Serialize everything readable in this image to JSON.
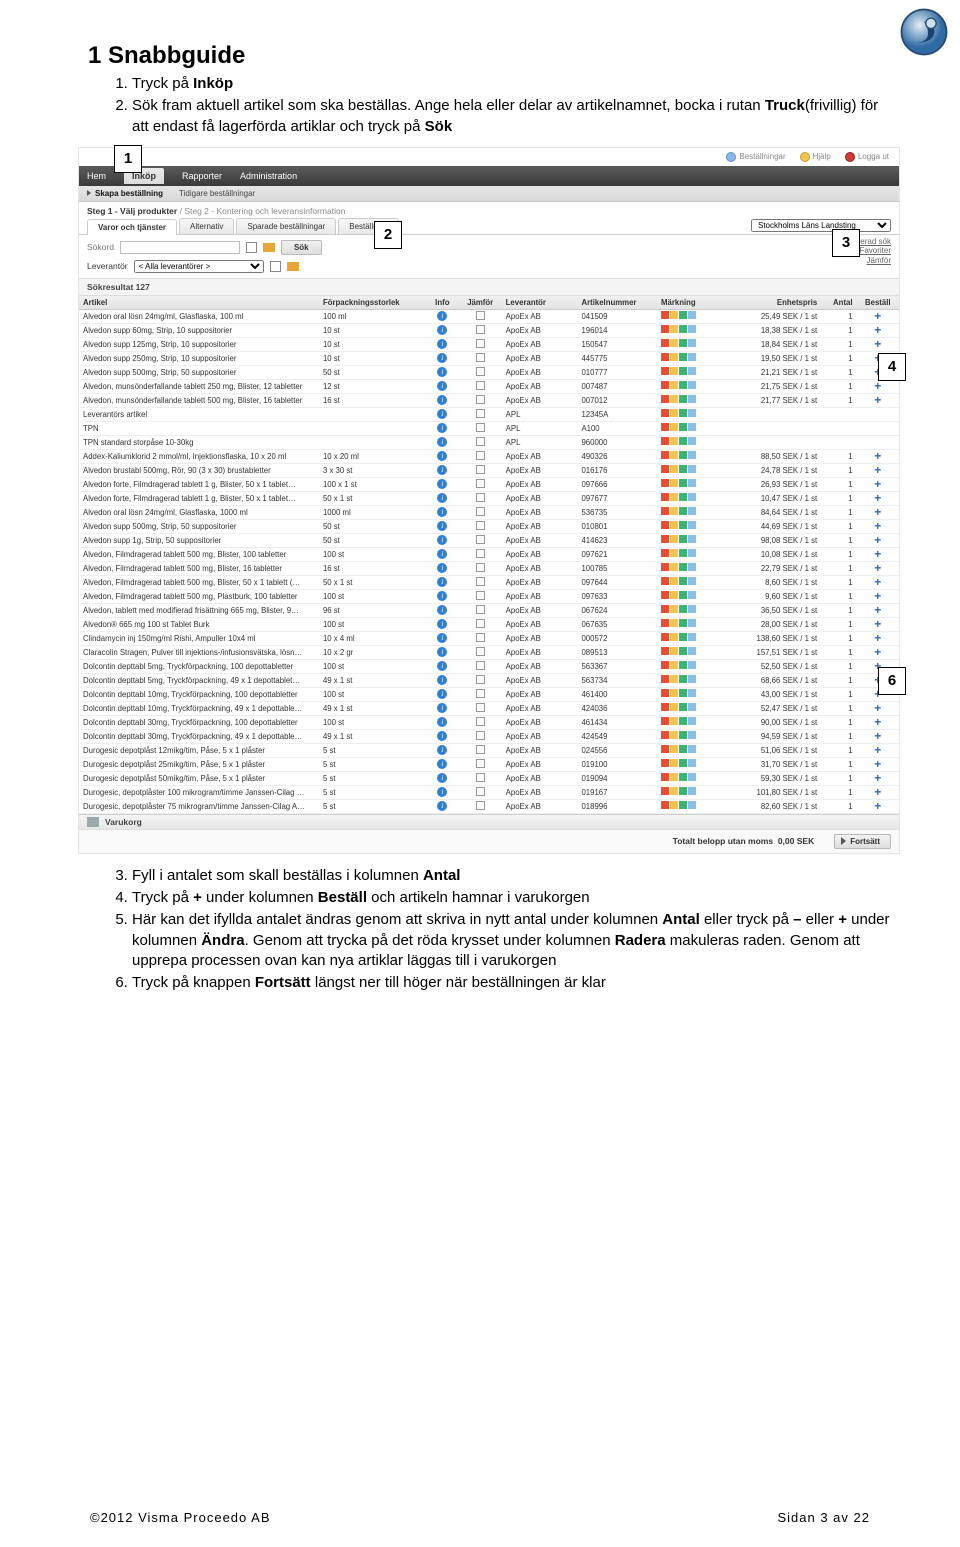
{
  "heading": "1 Snabbguide",
  "intro_items": [
    "Tryck på <b>Inköp</b>",
    "Sök fram aktuell artikel som ska beställas. Ange hela eller delar av artikelnamnet, bocka i rutan <b>Truck</b>(frivillig) för att endast få lagerförda artiklar och tryck på <b>Sök</b>"
  ],
  "after_start": 3,
  "after_items": [
    "Fyll i antalet som skall beställas i kolumnen <b>Antal</b>",
    "Tryck på <b>+</b> under kolumnen <b>Beställ</b> och artikeln hamnar i varukorgen",
    "Här kan det ifyllda antalet ändras genom att skriva in nytt antal under kolumnen <b>Antal</b> eller tryck på <b>–</b> eller <b>+</b> under kolumnen <b>Ändra</b>. Genom att trycka på det röda krysset under kolumnen <b>Radera</b> makuleras raden. Genom att upprepa processen ovan kan nya artiklar läggas till i varukorgen",
    "Tryck på knappen <b>Fortsätt</b> längst ner till höger när beställningen är klar"
  ],
  "topbar": {
    "bestallningar": "Beställningar",
    "hjalp": "Hjälp",
    "logga_ut": "Logga ut"
  },
  "nav": {
    "items": [
      "Hem",
      "Inköp",
      "Rapporter",
      "Administration"
    ],
    "active": "Inköp"
  },
  "subnav": {
    "skapa": "Skapa beställning",
    "tidigare": "Tidigare beställningar"
  },
  "steps_label": {
    "s1": "Steg 1 - Välj produkter",
    "sep": " / ",
    "s2": "Steg 2 - Kontering och leveransinformation"
  },
  "tabs": [
    "Varor och tjänster",
    "Alternativ",
    "Sparade beställningar",
    "Beställning"
  ],
  "org_dd": "Stockholms Läns Landsting",
  "search": {
    "sokord_label": "Sökord",
    "leverantor_label": "Leverantör",
    "leverantor_value": "< Alla leverantörer >",
    "sok_button": "Sök",
    "adv": "Avancerad sök",
    "fav": "Favoriter",
    "jamfor": "Jämför"
  },
  "sokresultat": "Sökresultat 127",
  "columns": [
    "Artikel",
    "Förpackningsstorlek",
    "Info",
    "Jämför",
    "Leverantör",
    "Artikelnummer",
    "Märkning",
    "Enhetspris",
    "Antal",
    "Beställ"
  ],
  "rows": [
    {
      "a": "Alvedon oral lösn 24mg/ml, Glasflaska, 100 ml",
      "p": "100 ml",
      "l": "ApoEx AB",
      "n": "041509",
      "pr": "25,49 SEK / 1 st",
      "q": "1"
    },
    {
      "a": "Alvedon supp 60mg, Strip, 10 suppositorier",
      "p": "10 st",
      "l": "ApoEx AB",
      "n": "196014",
      "pr": "18,38 SEK / 1 st",
      "q": "1"
    },
    {
      "a": "Alvedon supp 125mg, Strip, 10 suppositorier",
      "p": "10 st",
      "l": "ApoEx AB",
      "n": "150547",
      "pr": "18,84 SEK / 1 st",
      "q": "1"
    },
    {
      "a": "Alvedon supp 250mg, Strip, 10 suppositorier",
      "p": "10 st",
      "l": "ApoEx AB",
      "n": "445775",
      "pr": "19,50 SEK / 1 st",
      "q": "1"
    },
    {
      "a": "Alvedon supp 500mg, Strip, 50 suppositorier",
      "p": "50 st",
      "l": "ApoEx AB",
      "n": "010777",
      "pr": "21,21 SEK / 1 st",
      "q": "1"
    },
    {
      "a": "Alvedon, munsönderfallande tablett 250 mg, Blister, 12 tabletter",
      "p": "12 st",
      "l": "ApoEx AB",
      "n": "007487",
      "pr": "21,75 SEK / 1 st",
      "q": "1"
    },
    {
      "a": "Alvedon, munsönderfallande tablett 500 mg, Blister, 16 tabletter",
      "p": "16 st",
      "l": "ApoEx AB",
      "n": "007012",
      "pr": "21,77 SEK / 1 st",
      "q": "1"
    },
    {
      "a": "Leverantörs artikel",
      "p": "",
      "l": "APL",
      "n": "12345A",
      "pr": "",
      "q": ""
    },
    {
      "a": "TPN",
      "p": "",
      "l": "APL",
      "n": "A100",
      "pr": "",
      "q": ""
    },
    {
      "a": "TPN standard storpåse 10-30kg",
      "p": "",
      "l": "APL",
      "n": "960000",
      "pr": "",
      "q": ""
    },
    {
      "a": "Addex-Kaliumklorid 2 mmol/ml, Injektionsflaska, 10 x 20 ml",
      "p": "10 x 20 ml",
      "l": "ApoEx AB",
      "n": "490326",
      "pr": "88,50 SEK / 1 st",
      "q": "1"
    },
    {
      "a": "Alvedon brustabl 500mg, Rör, 90 (3 x 30) brustabletter",
      "p": "3 x 30 st",
      "l": "ApoEx AB",
      "n": "016176",
      "pr": "24,78 SEK / 1 st",
      "q": "1"
    },
    {
      "a": "Alvedon forte, Filmdragerad tablett 1 g, Blister, 50 x 1 tablet…",
      "p": "100 x 1 st",
      "l": "ApoEx AB",
      "n": "097666",
      "pr": "26,93 SEK / 1 st",
      "q": "1"
    },
    {
      "a": "Alvedon forte, Filmdragerad tablett 1 g, Blister, 50 x 1 tablet…",
      "p": "50 x 1 st",
      "l": "ApoEx AB",
      "n": "097677",
      "pr": "10,47 SEK / 1 st",
      "q": "1"
    },
    {
      "a": "Alvedon oral lösn 24mg/ml, Glasflaska, 1000 ml",
      "p": "1000 ml",
      "l": "ApoEx AB",
      "n": "536735",
      "pr": "84,64 SEK / 1 st",
      "q": "1"
    },
    {
      "a": "Alvedon supp 500mg, Strip, 50 suppositorier",
      "p": "50 st",
      "l": "ApoEx AB",
      "n": "010801",
      "pr": "44,69 SEK / 1 st",
      "q": "1"
    },
    {
      "a": "Alvedon supp 1g, Strip, 50 suppositorier",
      "p": "50 st",
      "l": "ApoEx AB",
      "n": "414623",
      "pr": "98,08 SEK / 1 st",
      "q": "1"
    },
    {
      "a": "Alvedon, Filmdragerad tablett 500 mg, Blister, 100 tabletter",
      "p": "100 st",
      "l": "ApoEx AB",
      "n": "097621",
      "pr": "10,08 SEK / 1 st",
      "q": "1"
    },
    {
      "a": "Alvedon, Filmdragerad tablett 500 mg, Blister, 16 tabletter",
      "p": "16 st",
      "l": "ApoEx AB",
      "n": "100785",
      "pr": "22,79 SEK / 1 st",
      "q": "1"
    },
    {
      "a": "Alvedon, Filmdragerad tablett 500 mg, Blister, 50 x 1 tablett (…",
      "p": "50 x 1 st",
      "l": "ApoEx AB",
      "n": "097644",
      "pr": "8,60 SEK / 1 st",
      "q": "1"
    },
    {
      "a": "Alvedon, Filmdragerad tablett 500 mg, Plastburk, 100 tabletter",
      "p": "100 st",
      "l": "ApoEx AB",
      "n": "097633",
      "pr": "9,60 SEK / 1 st",
      "q": "1"
    },
    {
      "a": "Alvedon, tablett med modifierad frisättning 665 mg, Blister, 9…",
      "p": "96 st",
      "l": "ApoEx AB",
      "n": "067624",
      "pr": "36,50 SEK / 1 st",
      "q": "1"
    },
    {
      "a": "Alvedon® 665 mg 100 st Tablet Burk",
      "p": "100 st",
      "l": "ApoEx AB",
      "n": "067635",
      "pr": "28,00 SEK / 1 st",
      "q": "1"
    },
    {
      "a": "Clindamycin inj 150mg/ml Rishi, Ampuller 10x4 ml",
      "p": "10 x 4 ml",
      "l": "ApoEx AB",
      "n": "000572",
      "pr": "138,60 SEK / 1 st",
      "q": "1"
    },
    {
      "a": "Claracolin Stragen, Pulver till injektions-/infusionsvätska, lösn…",
      "p": "10 x 2 gr",
      "l": "ApoEx AB",
      "n": "089513",
      "pr": "157,51 SEK / 1 st",
      "q": "1"
    },
    {
      "a": "Dolcontin depttabl 5mg, Tryckförpackning, 100 depottabletter",
      "p": "100 st",
      "l": "ApoEx AB",
      "n": "563367",
      "pr": "52,50 SEK / 1 st",
      "q": "1"
    },
    {
      "a": "Dolcontin depttabl 5mg, Tryckförpackning, 49 x 1 depottablet…",
      "p": "49 x 1 st",
      "l": "ApoEx AB",
      "n": "563734",
      "pr": "68,66 SEK / 1 st",
      "q": "1"
    },
    {
      "a": "Dolcontin depttabl 10mg, Tryckförpackning, 100 depottabletter",
      "p": "100 st",
      "l": "ApoEx AB",
      "n": "461400",
      "pr": "43,00 SEK / 1 st",
      "q": "1"
    },
    {
      "a": "Dolcontin depttabl 10mg, Tryckförpackning, 49 x 1 depottable…",
      "p": "49 x 1 st",
      "l": "ApoEx AB",
      "n": "424036",
      "pr": "52,47 SEK / 1 st",
      "q": "1"
    },
    {
      "a": "Dolcontin depttabl 30mg, Tryckförpackning, 100 depottabletter",
      "p": "100 st",
      "l": "ApoEx AB",
      "n": "461434",
      "pr": "90,00 SEK / 1 st",
      "q": "1"
    },
    {
      "a": "Dolcontin depttabl 30mg, Tryckförpackning, 49 x 1 depottable…",
      "p": "49 x 1 st",
      "l": "ApoEx AB",
      "n": "424549",
      "pr": "94,59 SEK / 1 st",
      "q": "1"
    },
    {
      "a": "Durogesic depotplåst 12mikg/tim, Påse, 5 x 1 plåster",
      "p": "5 st",
      "l": "ApoEx AB",
      "n": "024556",
      "pr": "51,06 SEK / 1 st",
      "q": "1"
    },
    {
      "a": "Durogesic depotplåst 25mikg/tim, Påse, 5 x 1 plåster",
      "p": "5 st",
      "l": "ApoEx AB",
      "n": "019100",
      "pr": "31,70 SEK / 1 st",
      "q": "1"
    },
    {
      "a": "Durogesic depotplåst 50mikg/tim, Påse, 5 x 1 plåster",
      "p": "5 st",
      "l": "ApoEx AB",
      "n": "019094",
      "pr": "59,30 SEK / 1 st",
      "q": "1"
    },
    {
      "a": "Durogesic, depotplåster 100 mikrogram/timme Janssen-Cilag …",
      "p": "5 st",
      "l": "ApoEx AB",
      "n": "019167",
      "pr": "101,80 SEK / 1 st",
      "q": "1"
    },
    {
      "a": "Durogesic, depotplåster 75 mikrogram/timme Janssen-Cilag A…",
      "p": "5 st",
      "l": "ApoEx AB",
      "n": "018996",
      "pr": "82,60 SEK / 1 st",
      "q": "1"
    }
  ],
  "varukorg": "Varukorg",
  "totals": {
    "label": "Totalt belopp utan moms",
    "value": "0,00 SEK"
  },
  "fortsatt": "Fortsätt",
  "footer": {
    "left": "©2012 Visma Proceedo AB",
    "right": "Sidan 3 av 22"
  },
  "callouts": [
    "1",
    "2",
    "3",
    "4",
    "6"
  ]
}
